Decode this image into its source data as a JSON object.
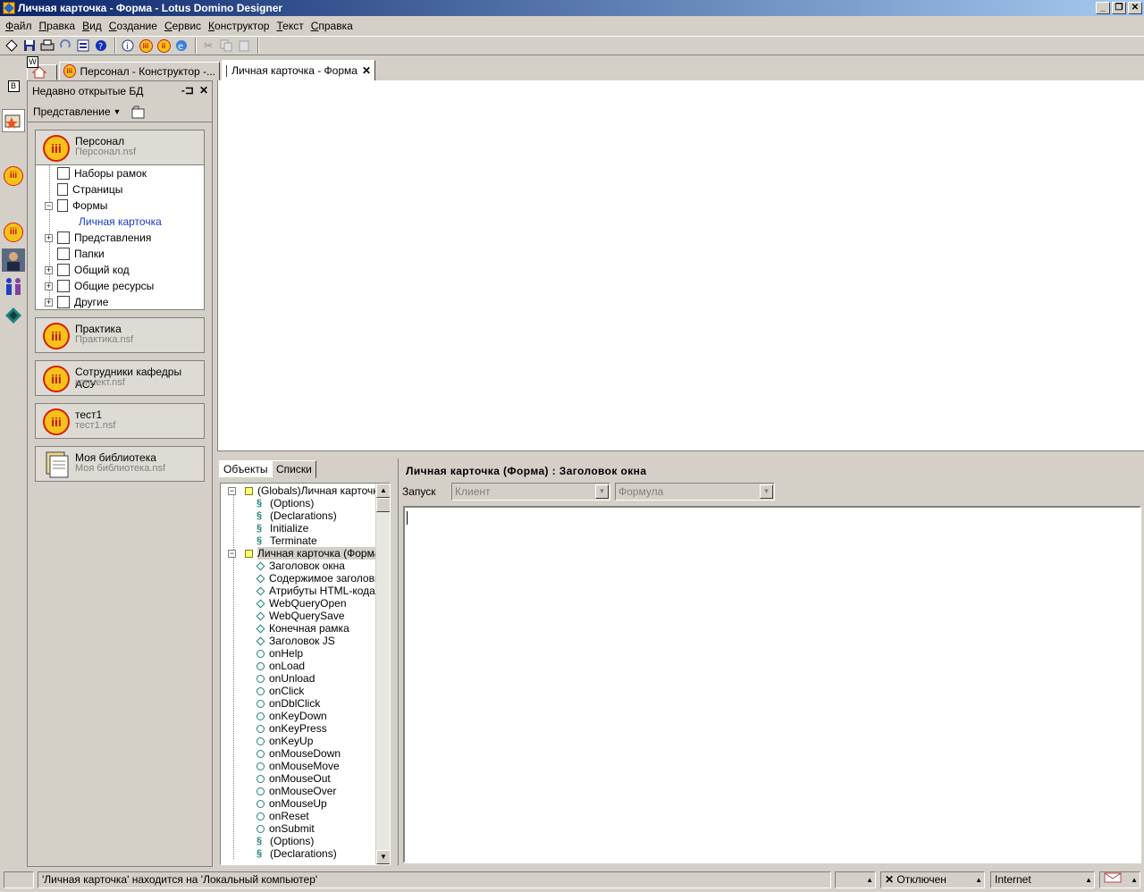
{
  "window": {
    "title": "Личная карточка - Форма - Lotus Domino Designer"
  },
  "menu": [
    "Файл",
    "Правка",
    "Вид",
    "Создание",
    "Сервис",
    "Конструктор",
    "Текст",
    "Справка"
  ],
  "toolbar": {
    "icons": [
      "new-icon",
      "save-icon",
      "print-icon",
      "refresh-icon",
      "properties-icon",
      "help-icon",
      "info-icon",
      "lotus-db-icon",
      "lock-db-icon",
      "web-preview-icon",
      "cut-icon",
      "copy-icon",
      "paste-icon"
    ]
  },
  "tabs": [
    {
      "label": "Персонал - Конструктор -...",
      "active": false
    },
    {
      "label": "Личная карточка - Форма",
      "active": true
    }
  ],
  "bookmarks": {
    "header": "Недавно открытые БД",
    "view_label": "Представление",
    "databases": [
      {
        "title": "Персонал",
        "file": "Персонал.nsf",
        "tree": [
          {
            "label": "Наборы рамок",
            "link": false
          },
          {
            "label": "Страницы",
            "link": false
          },
          {
            "label": "Формы",
            "link": false
          },
          {
            "label": "Личная карточка",
            "link": true
          },
          {
            "label": "Представления",
            "link": false
          },
          {
            "label": "Папки",
            "link": false
          },
          {
            "label": "Общий код",
            "link": false
          },
          {
            "label": "Общие ресурсы",
            "link": false
          },
          {
            "label": "Другие",
            "link": false
          }
        ]
      },
      {
        "title": "Практика",
        "file": "Практика.nsf"
      },
      {
        "title": "Сотрудники кафедры АСУ",
        "file": "коннект.nsf"
      },
      {
        "title": "тест1",
        "file": "тест1.nsf"
      },
      {
        "title": "Моя библиотека",
        "file": "Моя библиотека.nsf"
      }
    ]
  },
  "objects_pane": {
    "tabs": [
      "Объекты",
      "Списки"
    ],
    "items": [
      "(Globals)Личная карточка",
      "(Options)",
      "(Declarations)",
      "Initialize",
      "Terminate",
      "Личная карточка (Форма)",
      "Заголовок окна",
      "Содержимое заголовка",
      "Атрибуты HTML-кода",
      "WebQueryOpen",
      "WebQuerySave",
      "Конечная рамка",
      "Заголовок JS",
      "onHelp",
      "onLoad",
      "onUnload",
      "onClick",
      "onDblClick",
      "onKeyDown",
      "onKeyPress",
      "onKeyUp",
      "onMouseDown",
      "onMouseMove",
      "onMouseOut",
      "onMouseOver",
      "onMouseUp",
      "onReset",
      "onSubmit",
      "(Options)",
      "(Declarations)"
    ]
  },
  "script_pane": {
    "title": "Личная карточка (Форма) : Заголовок окна",
    "run_label": "Запуск",
    "client_value": "Клиент",
    "type_value": "Формула"
  },
  "status": {
    "message": "'Личная карточка' находится на 'Локальный компьютер'",
    "connection": "Отключен",
    "location": "Internet"
  }
}
